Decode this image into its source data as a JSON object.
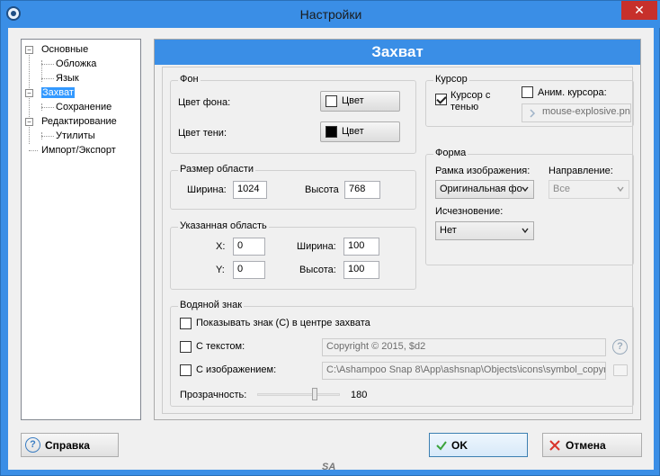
{
  "window": {
    "title": "Настройки",
    "close_glyph": "✕"
  },
  "colors": {
    "titlebar": "#3a8ee6",
    "close": "#c7302b",
    "selection": "#3399ff",
    "panel_header": "#3a8ee6"
  },
  "tree": {
    "items": [
      {
        "label": "Основные",
        "box": "−"
      },
      {
        "label": "Обложка"
      },
      {
        "label": "Язык"
      },
      {
        "label": "Захват",
        "box": "−",
        "selected": true
      },
      {
        "label": "Сохранение"
      },
      {
        "label": "Редактирование",
        "box": "−"
      },
      {
        "label": "Утилиты"
      },
      {
        "label": "Импорт/Экспорт"
      }
    ]
  },
  "panel": {
    "title": "Захват"
  },
  "bg": {
    "legend": "Фон",
    "bg_color_label": "Цвет фона:",
    "shadow_color_label": "Цвет тени:",
    "color_button": "Цвет",
    "bg_swatch": "#ffffff",
    "shadow_swatch": "#000000"
  },
  "area_size": {
    "legend": "Размер области",
    "width_label": "Ширина:",
    "width_value": "1024",
    "height_label": "Высота",
    "height_value": "768"
  },
  "custom_area": {
    "legend": "Указанная область",
    "x_label": "X:",
    "x_value": "0",
    "y_label": "Y:",
    "y_value": "0",
    "width_label": "Ширина:",
    "width_value": "100",
    "height_label": "Высота:",
    "height_value": "100"
  },
  "cursor": {
    "legend": "Курсор",
    "shadow_label": "Курсор с тенью",
    "shadow_line1": "Курсор с",
    "shadow_line2": "тенью",
    "shadow_checked": true,
    "animate_label": "Аним. курсора:",
    "animate_checked": false,
    "file_value": "mouse-explosive.pn",
    "file_icon": "chevron-right-icon"
  },
  "form": {
    "legend": "Форма",
    "frame_label": "Рамка изображения:",
    "frame_value": "Оригинальная фо",
    "direction_label": "Направление:",
    "direction_value": "Все",
    "fade_label": "Исчезновение:",
    "fade_value": "Нет"
  },
  "watermark": {
    "legend": "Водяной знак",
    "show_center_label": "Показывать знак (С) в центре захвата",
    "text_label": "С текстом:",
    "text_value": "Copyright © 2015, $d2",
    "image_label": "С изображением:",
    "image_value": "C:\\Ashampoo Snap 8\\App\\ashsnap\\Objects\\icons\\symbol_copyri",
    "transparency_label": "Прозрачность:",
    "transparency_value": "180",
    "transparency_fraction": 0.7
  },
  "footer": {
    "help_label": "Справка",
    "ok_label": "OK",
    "cancel_label": "Отмена",
    "signature": "SA"
  }
}
